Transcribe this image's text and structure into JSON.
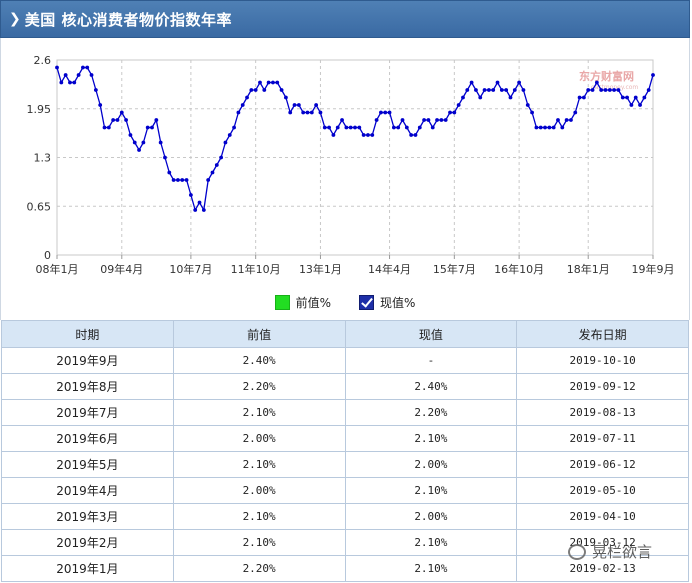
{
  "header": {
    "title": "美国 核心消费者物价指数年率"
  },
  "watermark": {
    "site": "东方财富网",
    "sub": "eastmoney.com",
    "wechat": "晃栏欲言"
  },
  "legend": {
    "prev": "前值%",
    "curr": "现值%"
  },
  "colors": {
    "line": "#0000cc",
    "prev": "#22dd22",
    "header": "#3f70a9"
  },
  "chart_data": {
    "type": "line",
    "title": "美国 核心消费者物价指数年率",
    "xlabel": "",
    "ylabel": "",
    "ylim": [
      0,
      2.6
    ],
    "yticks": [
      "2.6",
      "1.95",
      "1.3",
      "0.65",
      "0"
    ],
    "xtick_labels": [
      "08年1月",
      "09年4月",
      "10年7月",
      "11年10月",
      "13年1月",
      "14年4月",
      "15年7月",
      "16年10月",
      "18年1月",
      "19年9月"
    ],
    "grid": true,
    "legend": "bottom",
    "series": [
      {
        "name": "现值%",
        "start": "2008-01",
        "end": "2019-09",
        "frequency": "monthly",
        "values": [
          2.5,
          2.3,
          2.4,
          2.3,
          2.3,
          2.4,
          2.5,
          2.5,
          2.4,
          2.2,
          2.0,
          1.7,
          1.7,
          1.8,
          1.8,
          1.9,
          1.8,
          1.6,
          1.5,
          1.4,
          1.5,
          1.7,
          1.7,
          1.8,
          1.5,
          1.3,
          1.1,
          1.0,
          1.0,
          1.0,
          1.0,
          0.8,
          0.6,
          0.7,
          0.6,
          1.0,
          1.1,
          1.2,
          1.3,
          1.5,
          1.6,
          1.7,
          1.9,
          2.0,
          2.1,
          2.2,
          2.2,
          2.3,
          2.2,
          2.3,
          2.3,
          2.3,
          2.2,
          2.1,
          1.9,
          2.0,
          2.0,
          1.9,
          1.9,
          1.9,
          2.0,
          1.9,
          1.7,
          1.7,
          1.6,
          1.7,
          1.8,
          1.7,
          1.7,
          1.7,
          1.7,
          1.6,
          1.6,
          1.6,
          1.8,
          1.9,
          1.9,
          1.9,
          1.7,
          1.7,
          1.8,
          1.7,
          1.6,
          1.6,
          1.7,
          1.8,
          1.8,
          1.7,
          1.8,
          1.8,
          1.8,
          1.9,
          1.9,
          2.0,
          2.1,
          2.2,
          2.3,
          2.2,
          2.1,
          2.2,
          2.2,
          2.2,
          2.3,
          2.2,
          2.2,
          2.1,
          2.2,
          2.3,
          2.2,
          2.0,
          1.9,
          1.7,
          1.7,
          1.7,
          1.7,
          1.7,
          1.8,
          1.7,
          1.8,
          1.8,
          1.9,
          2.1,
          2.1,
          2.2,
          2.2,
          2.3,
          2.2,
          2.2,
          2.2,
          2.2,
          2.2,
          2.1,
          2.1,
          2.0,
          2.1,
          2.0,
          2.1,
          2.2,
          2.4
        ]
      }
    ]
  },
  "table": {
    "headers": [
      "时期",
      "前值",
      "现值",
      "发布日期"
    ],
    "rows": [
      [
        "2019年9月",
        "2.40%",
        "-",
        "2019-10-10"
      ],
      [
        "2019年8月",
        "2.20%",
        "2.40%",
        "2019-09-12"
      ],
      [
        "2019年7月",
        "2.10%",
        "2.20%",
        "2019-08-13"
      ],
      [
        "2019年6月",
        "2.00%",
        "2.10%",
        "2019-07-11"
      ],
      [
        "2019年5月",
        "2.10%",
        "2.00%",
        "2019-06-12"
      ],
      [
        "2019年4月",
        "2.00%",
        "2.10%",
        "2019-05-10"
      ],
      [
        "2019年3月",
        "2.10%",
        "2.00%",
        "2019-04-10"
      ],
      [
        "2019年2月",
        "2.10%",
        "2.10%",
        "2019-03-12"
      ],
      [
        "2019年1月",
        "2.20%",
        "2.10%",
        "2019-02-13"
      ]
    ]
  }
}
